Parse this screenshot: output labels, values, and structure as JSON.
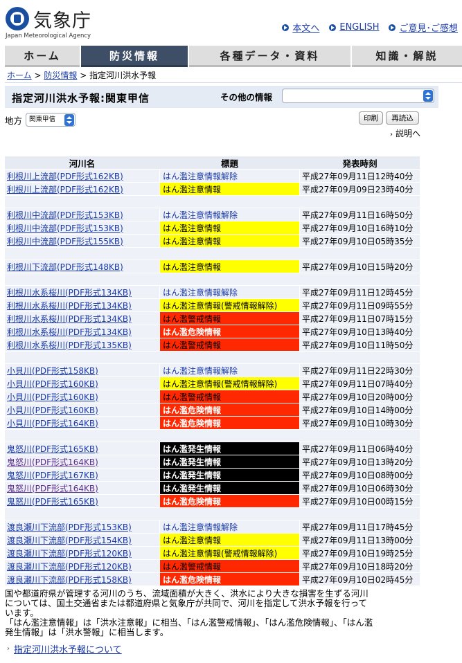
{
  "header": {
    "logo_jp": "気象庁",
    "logo_en": "Japan Meteorological Agency",
    "links": [
      "本文へ",
      "ENGLISH",
      "ご意見･ご感想"
    ]
  },
  "nav": {
    "tabs": [
      "ホーム",
      "防災情報",
      "各種データ・資料",
      "知識・解説"
    ],
    "active": "防災情報"
  },
  "breadcrumb": {
    "home": "ホーム",
    "sep": ">",
    "section": "防災情報",
    "current": "指定河川洪水予報"
  },
  "title": "指定河川洪水予報:関東甲信",
  "other_info_label": "その他の情報",
  "other_info_value": "",
  "region": {
    "label": "地方",
    "value": "関東甲信"
  },
  "buttons": {
    "print": "印刷",
    "reload": "再読込"
  },
  "explain_link": "説明へ",
  "table": {
    "headers": [
      "河川名",
      "標題",
      "発表時刻"
    ],
    "groups": [
      [
        {
          "river": "利根川上流部(PDF形式162KB)",
          "title": "はん濫注意情報解除",
          "level": "cancel",
          "time": "平成27年09月11日12時40分"
        },
        {
          "river": "利根川上流部(PDF形式162KB)",
          "title": "はん濫注意情報",
          "level": "info",
          "time": "平成27年09月09日23時40分"
        }
      ],
      [
        {
          "river": "利根川中流部(PDF形式153KB)",
          "title": "はん濫注意情報解除",
          "level": "cancel",
          "time": "平成27年09月11日16時50分"
        },
        {
          "river": "利根川中流部(PDF形式153KB)",
          "title": "はん濫注意情報",
          "level": "info",
          "time": "平成27年09月10日16時10分"
        },
        {
          "river": "利根川中流部(PDF形式155KB)",
          "title": "はん濫注意情報",
          "level": "info",
          "time": "平成27年09月10日05時35分"
        }
      ],
      [
        {
          "river": "利根川下流部(PDF形式148KB)",
          "title": "はん濫注意情報",
          "level": "info",
          "time": "平成27年09月10日15時20分"
        }
      ],
      [
        {
          "river": "利根川水系桜川(PDF形式134KB)",
          "title": "はん濫注意情報解除",
          "level": "cancel",
          "time": "平成27年09月11日12時45分"
        },
        {
          "river": "利根川水系桜川(PDF形式134KB)",
          "title": "はん濫注意情報(警戒情報解除)",
          "level": "info",
          "time": "平成27年09月11日09時55分"
        },
        {
          "river": "利根川水系桜川(PDF形式134KB)",
          "title": "はん濫警戒情報",
          "level": "warn",
          "time": "平成27年09月11日07時15分"
        },
        {
          "river": "利根川水系桜川(PDF形式134KB)",
          "title": "はん濫危険情報",
          "level": "danger",
          "time": "平成27年09月10日13時40分"
        },
        {
          "river": "利根川水系桜川(PDF形式135KB)",
          "title": "はん濫警戒情報",
          "level": "warn",
          "time": "平成27年09月10日11時50分"
        }
      ],
      [
        {
          "river": "小貝川(PDF形式158KB)",
          "title": "はん濫注意情報解除",
          "level": "cancel",
          "time": "平成27年09月11日22時30分"
        },
        {
          "river": "小貝川(PDF形式160KB)",
          "title": "はん濫注意情報(警戒情報解除)",
          "level": "info",
          "time": "平成27年09月11日07時40分"
        },
        {
          "river": "小貝川(PDF形式160KB)",
          "title": "はん濫警戒情報",
          "level": "warn",
          "time": "平成27年09月10日20時00分"
        },
        {
          "river": "小貝川(PDF形式160KB)",
          "title": "はん濫危険情報",
          "level": "danger",
          "time": "平成27年09月10日14時00分"
        },
        {
          "river": "小貝川(PDF形式164KB)",
          "title": "はん濫危険情報",
          "level": "danger",
          "time": "平成27年09月10日10時30分"
        }
      ],
      [
        {
          "river": "鬼怒川(PDF形式165KB)",
          "title": "はん濫発生情報",
          "level": "occur",
          "time": "平成27年09月11日06時40分"
        },
        {
          "river": "鬼怒川(PDF形式164KB)",
          "title": "はん濫発生情報",
          "level": "occur",
          "time": "平成27年09月10日13時20分",
          "visited": true
        },
        {
          "river": "鬼怒川(PDF形式167KB)",
          "title": "はん濫発生情報",
          "level": "occur",
          "time": "平成27年09月10日08時00分"
        },
        {
          "river": "鬼怒川(PDF形式164KB)",
          "title": "はん濫発生情報",
          "level": "occur",
          "time": "平成27年09月10日06時30分",
          "visited": true
        },
        {
          "river": "鬼怒川(PDF形式165KB)",
          "title": "はん濫危険情報",
          "level": "danger",
          "time": "平成27年09月10日00時15分"
        }
      ],
      [
        {
          "river": "渡良瀬川下流部(PDF形式153KB)",
          "title": "はん濫注意情報解除",
          "level": "cancel",
          "time": "平成27年09月11日17時45分"
        },
        {
          "river": "渡良瀬川下流部(PDF形式154KB)",
          "title": "はん濫注意情報",
          "level": "info",
          "time": "平成27年09月11日13時00分"
        },
        {
          "river": "渡良瀬川下流部(PDF形式120KB)",
          "title": "はん濫注意情報(警戒情報解除)",
          "level": "info",
          "time": "平成27年09月10日19時25分"
        },
        {
          "river": "渡良瀬川下流部(PDF形式120KB)",
          "title": "はん濫警戒情報",
          "level": "warn",
          "time": "平成27年09月10日18時20分"
        },
        {
          "river": "渡良瀬川下流部(PDF形式158KB)",
          "title": "はん濫危険情報",
          "level": "danger",
          "time": "平成27年09月10日02時45分"
        }
      ]
    ]
  },
  "note": "国や都道府県が管理する河川のうち、流域面積が大きく、洪水により大きな損害を生ずる河川については、国土交通省または都道府県と気象庁が共同で、河川を指定して洪水予報を行っています。「はん濫注意情報」は「洪水注意報」に相当、「はん濫警戒情報」、「はん濫危険情報」、「はん濫発生情報」は「洪水警報」に相当します。",
  "note_lines": [
    "国や都道府県が管理する河川のうち、流域面積が大きく、洪水により大きな損害を生ずる河川",
    "については、国土交通省または都道府県と気象庁が共同で、河川を指定して洪水予報を行って",
    "います。",
    "「はん濫注意情報」は「洪水注意報」に相当、「はん濫警戒情報」、「はん濫危険情報」、「はん濫",
    "発生情報」は「洪水警報」に相当します。"
  ],
  "about_link": "指定河川洪水予報について",
  "colors": {
    "accent": "#1a4fa0",
    "nav_active": "#3d4e66",
    "info": "#ffff00",
    "warn": "#ff2800",
    "occur": "#000000"
  }
}
